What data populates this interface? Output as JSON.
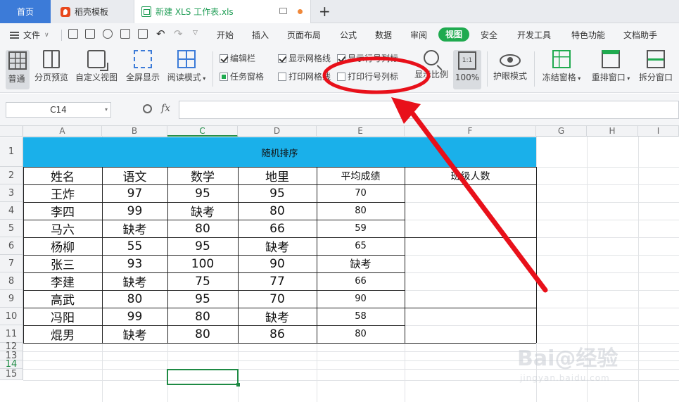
{
  "tabs": {
    "home": "首页",
    "template": "稻壳模板",
    "document": "新建 XLS 工作表.xls",
    "add": "+"
  },
  "menu": {
    "file": "文件",
    "items": [
      "开始",
      "插入",
      "页面布局",
      "公式",
      "数据",
      "审阅",
      "视图",
      "安全",
      "开发工具",
      "特色功能",
      "文档助手"
    ],
    "active": "视图"
  },
  "ribbon": {
    "normal": "普通",
    "page_preview": "分页预览",
    "custom_view": "自定义视图",
    "fullscreen": "全屏显示",
    "reading_mode": "阅读模式",
    "checks": {
      "formula_bar": {
        "label": "编辑栏",
        "checked": true
      },
      "task_pane": {
        "label": "任务窗格",
        "checked": true
      },
      "show_gridlines": {
        "label": "显示网格线",
        "checked": true
      },
      "print_gridlines": {
        "label": "打印网格线",
        "checked": false
      },
      "show_headers": {
        "label": "显示行号列标",
        "checked": true
      },
      "print_headers": {
        "label": "打印行号列标",
        "checked": false
      }
    },
    "zoom": "显示比例",
    "zoom100": "100%",
    "zoom100_icon": "1:1",
    "eye_mode": "护眼模式",
    "freeze": "冻结窗格",
    "rearrange": "重排窗口",
    "split": "拆分窗口"
  },
  "formula_bar": {
    "cell_ref": "C14",
    "fx": "fx",
    "value": ""
  },
  "sheet": {
    "columns": [
      "A",
      "B",
      "C",
      "D",
      "E",
      "F",
      "G",
      "H",
      "I"
    ],
    "rows": [
      "1",
      "2",
      "3",
      "4",
      "5",
      "6",
      "7",
      "8",
      "9",
      "10",
      "11",
      "12",
      "13",
      "14",
      "15"
    ],
    "active_cell": "C14",
    "title": "随机排序",
    "headers": [
      "姓名",
      "语文",
      "数学",
      "地里",
      "平均成绩",
      "班级人数"
    ],
    "data": [
      [
        "王炸",
        "97",
        "95",
        "95",
        "70"
      ],
      [
        "李四",
        "99",
        "缺考",
        "80",
        "80"
      ],
      [
        "马六",
        "缺考",
        "80",
        "66",
        "59"
      ],
      [
        "杨柳",
        "55",
        "95",
        "缺考",
        "65"
      ],
      [
        "张三",
        "93",
        "100",
        "90",
        "缺考"
      ],
      [
        "李建",
        "缺考",
        "75",
        "77",
        "66"
      ],
      [
        "高武",
        "80",
        "95",
        "70",
        "90"
      ],
      [
        "冯阳",
        "99",
        "80",
        "缺考",
        "58"
      ],
      [
        "焜男",
        "缺考",
        "80",
        "86",
        "80"
      ]
    ],
    "title_color": "#1ab0ea"
  },
  "annotation": {
    "color": "#e8101a",
    "target": "print_headers"
  },
  "watermark": {
    "brand": "Bai@经验",
    "url": "jingyan.baidu.com"
  }
}
